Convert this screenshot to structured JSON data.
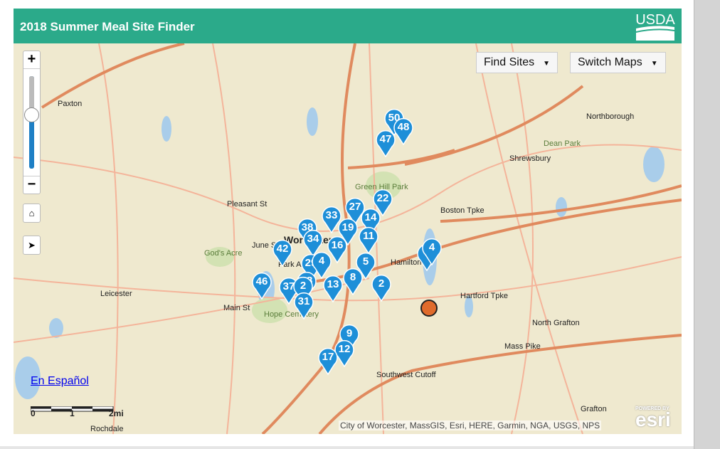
{
  "header": {
    "title": "2018 Summer Meal Site Finder",
    "logo": "USDA"
  },
  "controls": {
    "zoom_in": "+",
    "zoom_out": "−",
    "home_icon": "home-icon",
    "locate_icon": "locate-arrow-icon",
    "zoom_level_percent": 62
  },
  "toolbar": {
    "find_sites": "Find Sites",
    "switch_maps": "Switch Maps"
  },
  "places": [
    "Paxton",
    "Northborough",
    "Shrewsbury",
    "Leicester",
    "North Grafton",
    "Worcester",
    "God's Acre",
    "Hope Cemetery",
    "Green Hill Park",
    "Dean Park",
    "Grafton",
    "Rochdale",
    "Boston Tpke",
    "Hartford Tpke",
    "Mass Pike",
    "Hamilton St",
    "Main St",
    "June St",
    "Pleasant St",
    "Park Ave",
    "Southwest Cutoff"
  ],
  "sites": [
    "50",
    "48",
    "47",
    "22",
    "27",
    "14",
    "33",
    "19",
    "11",
    "38",
    "34",
    "16",
    "42",
    "29",
    "4",
    "5",
    "8",
    "2",
    "13",
    "37",
    "46",
    "28",
    "2",
    "31",
    "9",
    "12",
    "17",
    "7",
    "4"
  ],
  "language_link": "En Español",
  "scale": {
    "labels": [
      "0",
      "1",
      "2mi"
    ]
  },
  "attribution": "City of Worcester, MassGIS, Esri, HERE, Garmin, NGA, USGS, NPS",
  "esri": {
    "powered": "POWERED BY",
    "brand": "esri"
  },
  "colors": {
    "header": "#2baa8a",
    "pin": "#1e8fd8",
    "selected": "#e06b2c"
  }
}
